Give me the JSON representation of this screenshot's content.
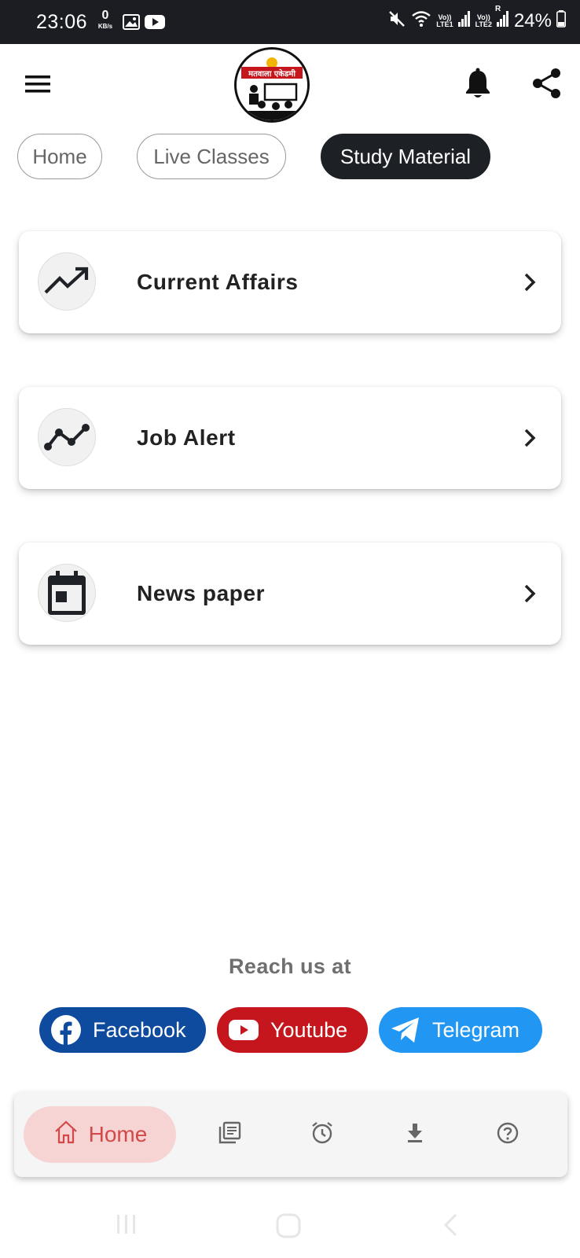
{
  "status_bar": {
    "time": "23:06",
    "net_speed_value": "0",
    "net_speed_unit": "KB/s",
    "sim1_top": "Vo))",
    "sim1_bottom": "LTE1",
    "sim2_top": "Vo))",
    "sim2_bottom": "LTE2",
    "roaming": "R",
    "battery": "24%"
  },
  "header": {
    "logo_text": "मतवाला एकेडमी",
    "menu_icon": "hamburger-icon",
    "notification_icon": "bell-icon",
    "share_icon": "share-icon"
  },
  "tabs": [
    {
      "label": "Home",
      "active": false
    },
    {
      "label": "Live Classes",
      "active": false
    },
    {
      "label": "Study Material",
      "active": true
    }
  ],
  "cards": [
    {
      "label": "Current Affairs",
      "icon": "trending-up-icon"
    },
    {
      "label": "Job Alert",
      "icon": "timeline-icon"
    },
    {
      "label": "News paper",
      "icon": "calendar-icon"
    }
  ],
  "reach": {
    "title": "Reach us at",
    "links": [
      {
        "label": "Facebook",
        "icon": "facebook-icon",
        "color": "#0e4a9e"
      },
      {
        "label": "Youtube",
        "icon": "youtube-icon",
        "color": "#c4161c"
      },
      {
        "label": "Telegram",
        "icon": "telegram-icon",
        "color": "#2196f3"
      }
    ]
  },
  "bottom_nav": {
    "active_label": "Home",
    "active_color": "#d34848",
    "items": [
      "home-icon",
      "library-books-icon",
      "alarm-icon",
      "download-icon",
      "help-icon"
    ]
  }
}
